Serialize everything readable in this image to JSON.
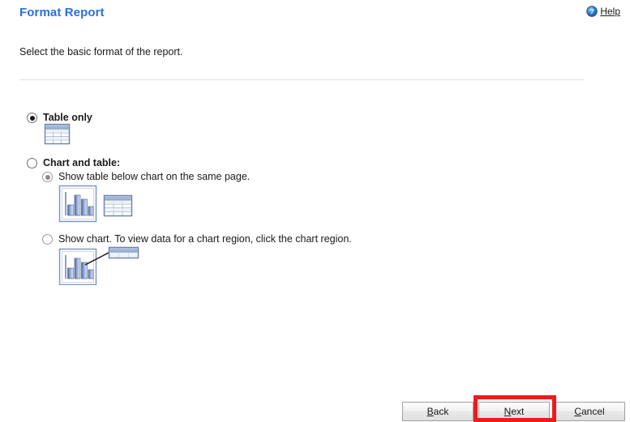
{
  "header": {
    "title": "Format Report",
    "help_label": "Help",
    "help_icon": "help-circle-icon"
  },
  "instruction": "Select the basic format of the report.",
  "options": [
    {
      "id": "table-only",
      "label": "Table only",
      "selected": true,
      "icon": "table-icon"
    },
    {
      "id": "chart-and-table",
      "label": "Chart and table:",
      "selected": false,
      "suboptions": [
        {
          "id": "show-table-below-chart",
          "label": "Show table below chart on the same page.",
          "selected": true,
          "icon": "chart-and-table-icon"
        },
        {
          "id": "show-chart-click-region",
          "label": "Show chart. To view data for a chart region, click the chart region.",
          "selected": false,
          "icon": "chart-with-callout-table-icon"
        }
      ]
    }
  ],
  "buttons": [
    {
      "id": "back",
      "label": "Back",
      "accel": "B",
      "rest": "ack",
      "highlighted": false
    },
    {
      "id": "next",
      "label": "Next",
      "accel": "N",
      "rest": "ext",
      "highlighted": true
    },
    {
      "id": "cancel",
      "label": "Cancel",
      "accel": "C",
      "rest": "ancel",
      "highlighted": false
    }
  ],
  "colors": {
    "title": "#2B70D8",
    "highlight": "#EE1B1B",
    "divider": "#E3E3E5",
    "icon_blue": "#7B94C4",
    "icon_blue_dark": "#5A73A8"
  }
}
